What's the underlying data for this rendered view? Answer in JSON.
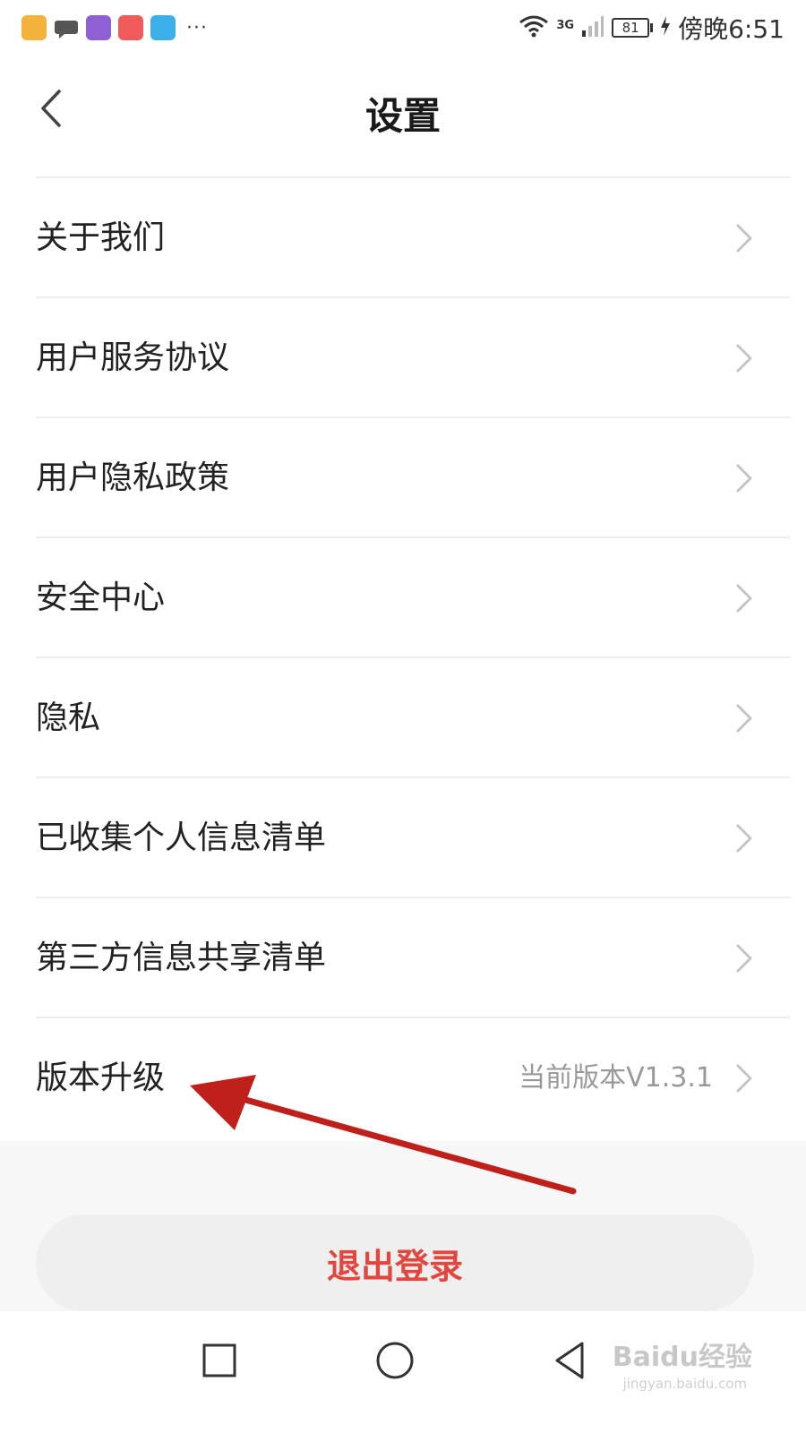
{
  "status_bar": {
    "time": "傍晚6:51",
    "battery": "81",
    "network": "3G",
    "more": "···"
  },
  "header": {
    "title": "设置"
  },
  "menu": {
    "items": [
      {
        "label": "关于我们"
      },
      {
        "label": "用户服务协议"
      },
      {
        "label": "用户隐私政策"
      },
      {
        "label": "安全中心"
      },
      {
        "label": "隐私"
      },
      {
        "label": "已收集个人信息清单"
      },
      {
        "label": "第三方信息共享清单"
      },
      {
        "label": "版本升级",
        "value": "当前版本V1.3.1"
      }
    ]
  },
  "logout": {
    "label": "退出登录"
  },
  "watermark": {
    "brand": "Baidu经验",
    "url": "jingyan.baidu.com"
  },
  "colors": {
    "accent_red": "#e3463c",
    "arrow_red": "#c0201a",
    "divider": "#eeeeee"
  }
}
